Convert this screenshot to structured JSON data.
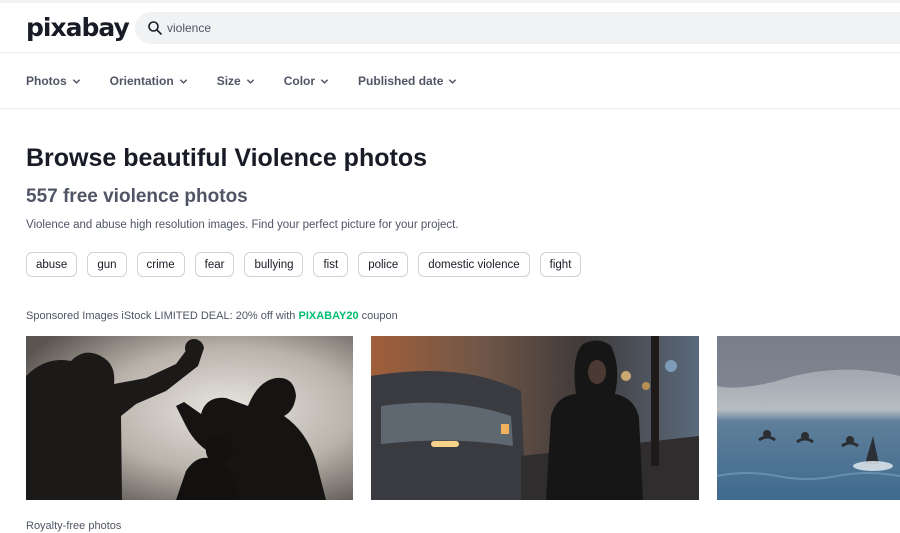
{
  "header": {
    "logo": "pixabay",
    "search": {
      "value": "violence",
      "icon": "search-icon"
    }
  },
  "filters": [
    {
      "label": "Photos",
      "icon": "chevron-down-icon"
    },
    {
      "label": "Orientation",
      "icon": "chevron-down-icon"
    },
    {
      "label": "Size",
      "icon": "chevron-down-icon"
    },
    {
      "label": "Color",
      "icon": "chevron-down-icon"
    },
    {
      "label": "Published date",
      "icon": "chevron-down-icon"
    }
  ],
  "main": {
    "title": "Browse beautiful Violence photos",
    "count_text": "557 free violence photos",
    "description": "Violence and abuse high resolution images. Find your perfect picture for your project."
  },
  "tags": [
    "abuse",
    "gun",
    "crime",
    "fear",
    "bullying",
    "fist",
    "police",
    "domestic violence",
    "fight"
  ],
  "sponsored": {
    "prefix": "Sponsored Images iStock LIMITED DEAL: 20% off with ",
    "code": "PIXABAY20",
    "suffix": " coupon"
  },
  "photos": [
    {
      "kind": "domestic-violence-silhouette"
    },
    {
      "kind": "hooded-person-street"
    },
    {
      "kind": "swimmers-with-shark-fin"
    }
  ],
  "footer": {
    "section_label": "Royalty-free photos"
  },
  "colors": {
    "accent": "#02be6e",
    "text": "#191b26",
    "muted": "#505565",
    "search_bg": "#f1f2f4"
  }
}
